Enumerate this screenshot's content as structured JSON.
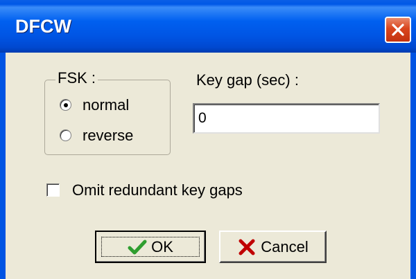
{
  "window": {
    "title": "DFCW",
    "close_icon": "close-x-icon"
  },
  "fsk": {
    "label": "FSK :",
    "options": [
      {
        "label": "normal",
        "selected": true
      },
      {
        "label": "reverse",
        "selected": false
      }
    ]
  },
  "key_gap": {
    "label": "Key gap (sec) :",
    "value": "0"
  },
  "omit_gaps": {
    "label": "Omit redundant key gaps",
    "checked": false
  },
  "buttons": {
    "ok": {
      "label": "OK",
      "icon": "check-icon"
    },
    "cancel": {
      "label": "Cancel",
      "icon": "x-icon"
    }
  },
  "colors": {
    "titlebar": "#0054e3",
    "dialog_bg": "#ece9d8",
    "close_button": "#d9451d",
    "ok_check": "#2f9e2f",
    "cancel_x": "#c00000"
  }
}
